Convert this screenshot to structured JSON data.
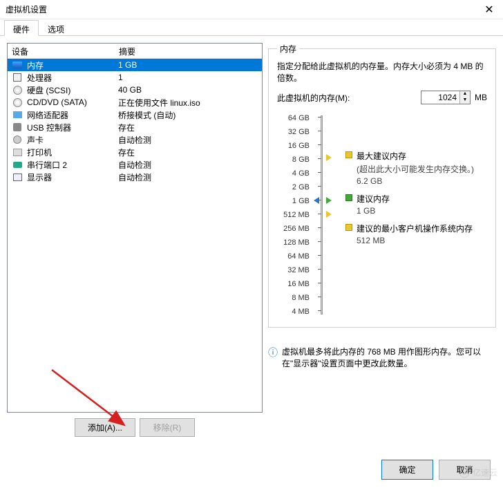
{
  "window": {
    "title": "虚拟机设置"
  },
  "tabs": {
    "hardware": "硬件",
    "options": "选项"
  },
  "columns": {
    "device": "设备",
    "summary": "摘要"
  },
  "devices": [
    {
      "icon": "memory",
      "name": "内存",
      "summary": "1 GB",
      "selected": true
    },
    {
      "icon": "cpu",
      "name": "处理器",
      "summary": "1"
    },
    {
      "icon": "disk",
      "name": "硬盘 (SCSI)",
      "summary": "40 GB"
    },
    {
      "icon": "cd",
      "name": "CD/DVD (SATA)",
      "summary": "正在使用文件 linux.iso"
    },
    {
      "icon": "net",
      "name": "网络适配器",
      "summary": "桥接模式 (自动)"
    },
    {
      "icon": "usb",
      "name": "USB 控制器",
      "summary": "存在"
    },
    {
      "icon": "sound",
      "name": "声卡",
      "summary": "自动检测"
    },
    {
      "icon": "printer",
      "name": "打印机",
      "summary": "存在"
    },
    {
      "icon": "serial",
      "name": "串行端口 2",
      "summary": "自动检测"
    },
    {
      "icon": "monitor",
      "name": "显示器",
      "summary": "自动检测"
    }
  ],
  "buttons": {
    "add": "添加(A)...",
    "remove": "移除(R)",
    "ok": "确定",
    "cancel": "取消"
  },
  "memory": {
    "group_title": "内存",
    "description": "指定分配给此虚拟机的内存量。内存大小必须为 4 MB 的倍数。",
    "label": "此虚拟机的内存(M):",
    "value": "1024",
    "unit": "MB",
    "ticks": [
      "64 GB",
      "32 GB",
      "16 GB",
      "8 GB",
      "4 GB",
      "2 GB",
      "1 GB",
      "512 MB",
      "256 MB",
      "128 MB",
      "64 MB",
      "32 MB",
      "16 MB",
      "8 MB",
      "4 MB"
    ],
    "legend": {
      "max": {
        "title": "最大建议内存",
        "note": "(超出此大小可能发生内存交换。)",
        "value": "6.2 GB"
      },
      "rec": {
        "title": "建议内存",
        "value": "1 GB"
      },
      "min": {
        "title": "建议的最小客户机操作系统内存",
        "value": "512 MB"
      }
    },
    "info": "虚拟机最多将此内存的 768 MB 用作图形内存。您可以在\"显示器\"设置页面中更改此数量。"
  },
  "watermark": "亿速云"
}
